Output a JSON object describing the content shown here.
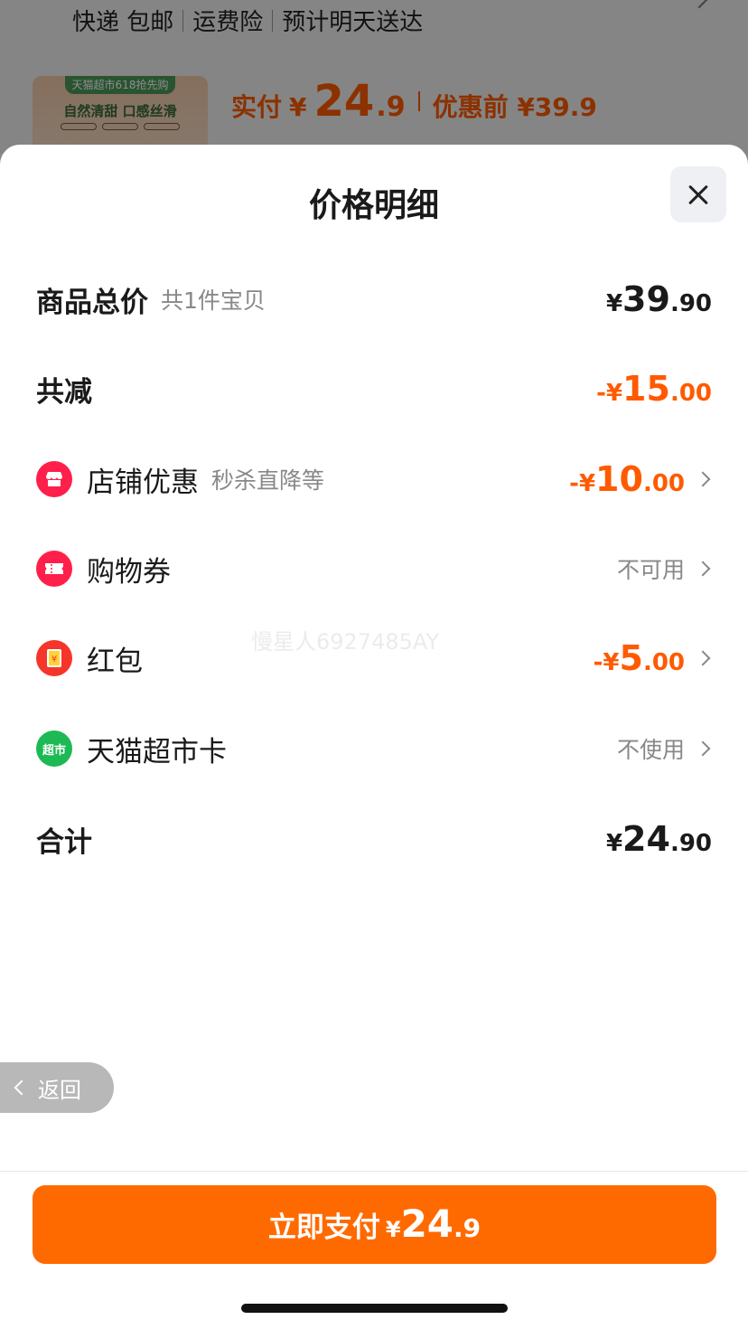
{
  "background": {
    "shipping": [
      "快递 包邮",
      "运费险",
      "预计明天送达"
    ],
    "product_badge": "天猫超市618抢先购",
    "product_slogan": "自然清甜 口感丝滑",
    "price_label": "实付",
    "price_currency": "¥",
    "price_int": "24",
    "price_dec": ".9",
    "orig_price": "优惠前 ¥39.9"
  },
  "sheet": {
    "title": "价格明细",
    "watermark": "慢星人6927485AY",
    "rows": {
      "total": {
        "label": "商品总价",
        "sub": "共1件宝贝",
        "cur": "¥",
        "int": "39",
        "dec": ".90"
      },
      "reduce": {
        "label": "共减",
        "cur": "-¥",
        "int": "15",
        "dec": ".00"
      },
      "shop": {
        "label": "店铺优惠",
        "sub": "秒杀直降等",
        "cur": "-¥",
        "int": "10",
        "dec": ".00",
        "icon": "store-icon"
      },
      "coupon": {
        "label": "购物券",
        "status": "不可用",
        "icon": "ticket-icon"
      },
      "redpacket": {
        "label": "红包",
        "cur": "-¥",
        "int": "5",
        "dec": ".00",
        "icon": "red-packet-icon"
      },
      "card": {
        "label": "天猫超市卡",
        "status": "不使用",
        "icon_text": "超市",
        "icon": "tmall-supermarket-icon"
      },
      "sum": {
        "label": "合计",
        "cur": "¥",
        "int": "24",
        "dec": ".90"
      }
    }
  },
  "back_button": {
    "label": "返回"
  },
  "pay_button": {
    "label": "立即支付",
    "cur": "¥",
    "int": "24",
    "dec": ".9"
  },
  "colors": {
    "accent": "#ff6a00",
    "discount": "#ff5a00"
  }
}
